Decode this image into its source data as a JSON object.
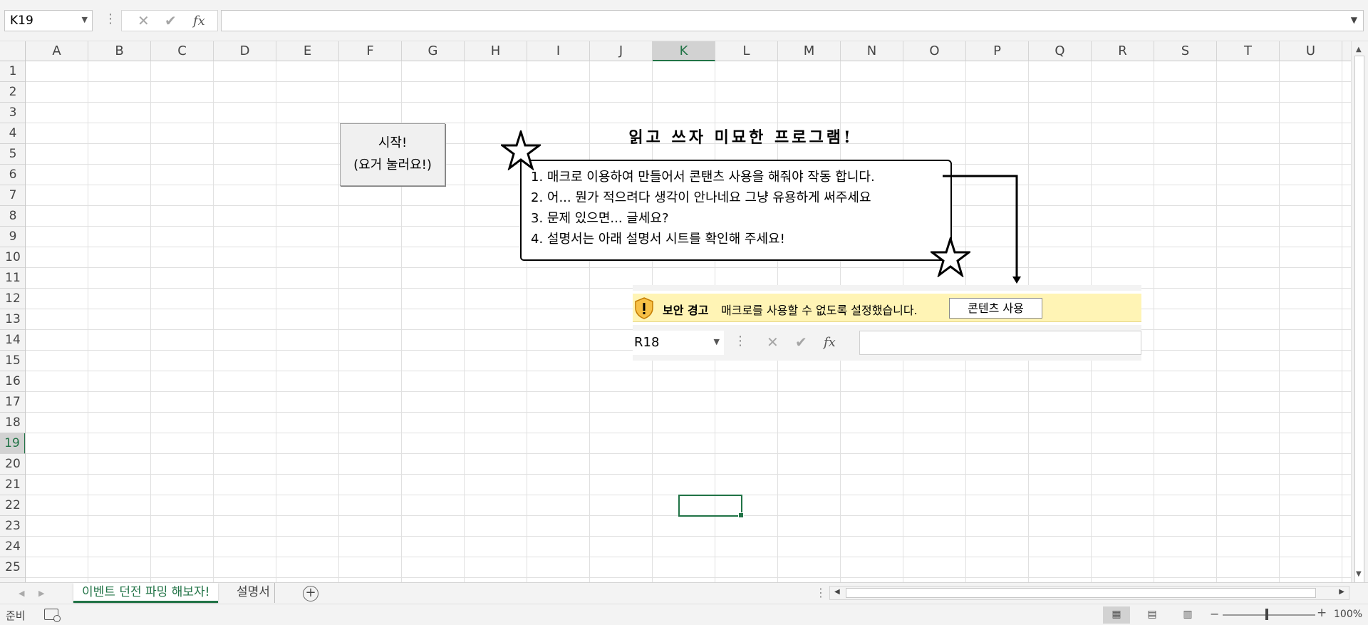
{
  "formula_bar": {
    "name_box": "K19",
    "cancel_icon": "✕",
    "enter_icon": "✔",
    "fx_label": "fx",
    "formula": ""
  },
  "columns": [
    "A",
    "B",
    "C",
    "D",
    "E",
    "F",
    "G",
    "H",
    "I",
    "J",
    "K",
    "L",
    "M",
    "N",
    "O",
    "P",
    "Q",
    "R",
    "S",
    "T",
    "U"
  ],
  "active_column": "K",
  "rows": [
    "1",
    "2",
    "3",
    "4",
    "5",
    "6",
    "7",
    "8",
    "9",
    "10",
    "11",
    "12",
    "13",
    "14",
    "15",
    "16",
    "17",
    "18",
    "19",
    "20",
    "21",
    "22",
    "23",
    "24",
    "25"
  ],
  "active_row": "19",
  "start_button": {
    "line1": "시작!",
    "line2": "(요거 눌러요!)"
  },
  "title": "읽고 쓰자 미묘한 프로그램!",
  "info_lines": [
    "1. 매크로 이용하여 만들어서 콘탠츠 사용을 해줘야 작동 합니다.",
    "2. 어... 뭔가 적으려다 생각이 안나네요 그냥 유용하게 써주세요",
    "3. 문제 있으면... 글세요?",
    "4. 설명서는 아래 설명서 시트를 확인해 주세요!"
  ],
  "embedded_screenshot": {
    "security_title": "보안 경고",
    "security_message": "매크로를 사용할 수 없도록 설정했습니다.",
    "enable_button": "콘텐츠 사용",
    "name_box": "R18",
    "fx_label": "fx"
  },
  "sheet_tabs": {
    "active": "이벤트 던전 파밍 해보자!",
    "other": "설명서"
  },
  "status": {
    "ready": "준비",
    "zoom": "100%"
  },
  "icons": {
    "star": "star-icon",
    "shield": "warning-shield-icon",
    "add_sheet": "plus-icon"
  },
  "colors": {
    "accent": "#217346",
    "security_bar": "#fff4b5"
  }
}
